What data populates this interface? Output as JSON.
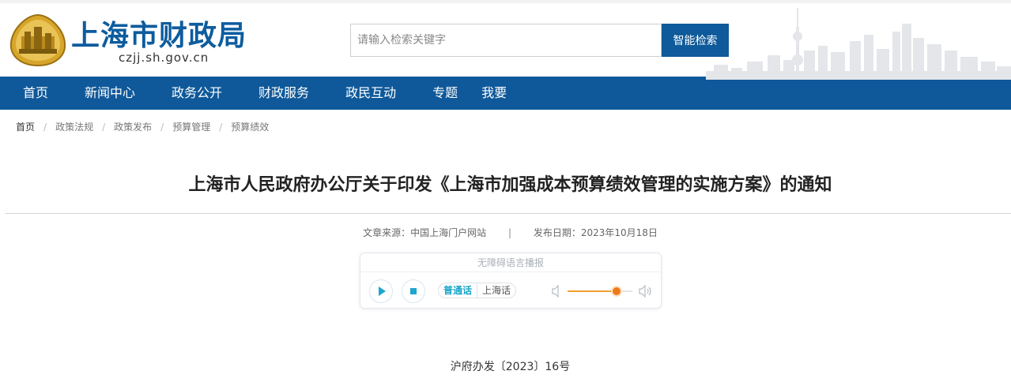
{
  "header": {
    "site_title": "上海市财政局",
    "site_domain": "czjj.sh.gov.cn",
    "search": {
      "placeholder": "请输入检索关键字",
      "button_label": "智能检索"
    }
  },
  "nav": {
    "items": [
      {
        "label": "首页"
      },
      {
        "label": "新闻中心"
      },
      {
        "label": "政务公开"
      },
      {
        "label": "财政服务"
      },
      {
        "label": "政民互动"
      },
      {
        "label": "专题"
      },
      {
        "label": "我要"
      }
    ]
  },
  "breadcrumb": [
    "首页",
    "政策法规",
    "政策发布",
    "预算管理",
    "预算绩效"
  ],
  "article": {
    "title": "上海市人民政府办公厅关于印发《上海市加强成本预算绩效管理的实施方案》的通知",
    "source_label": "文章来源：中国上海门户网站",
    "date_label": "发布日期：2023年10月18日",
    "doc_number": "沪府办发〔2023〕16号"
  },
  "player": {
    "title": "无障碍语言播报",
    "lang_active": "普通话",
    "lang_other": "上海话",
    "volume_level": 0.76,
    "colors": {
      "accent": "#18a4c8",
      "volume": "#f07a1a"
    }
  },
  "colors": {
    "brand": "#0f599a",
    "title_blue": "#0d5c9e"
  }
}
